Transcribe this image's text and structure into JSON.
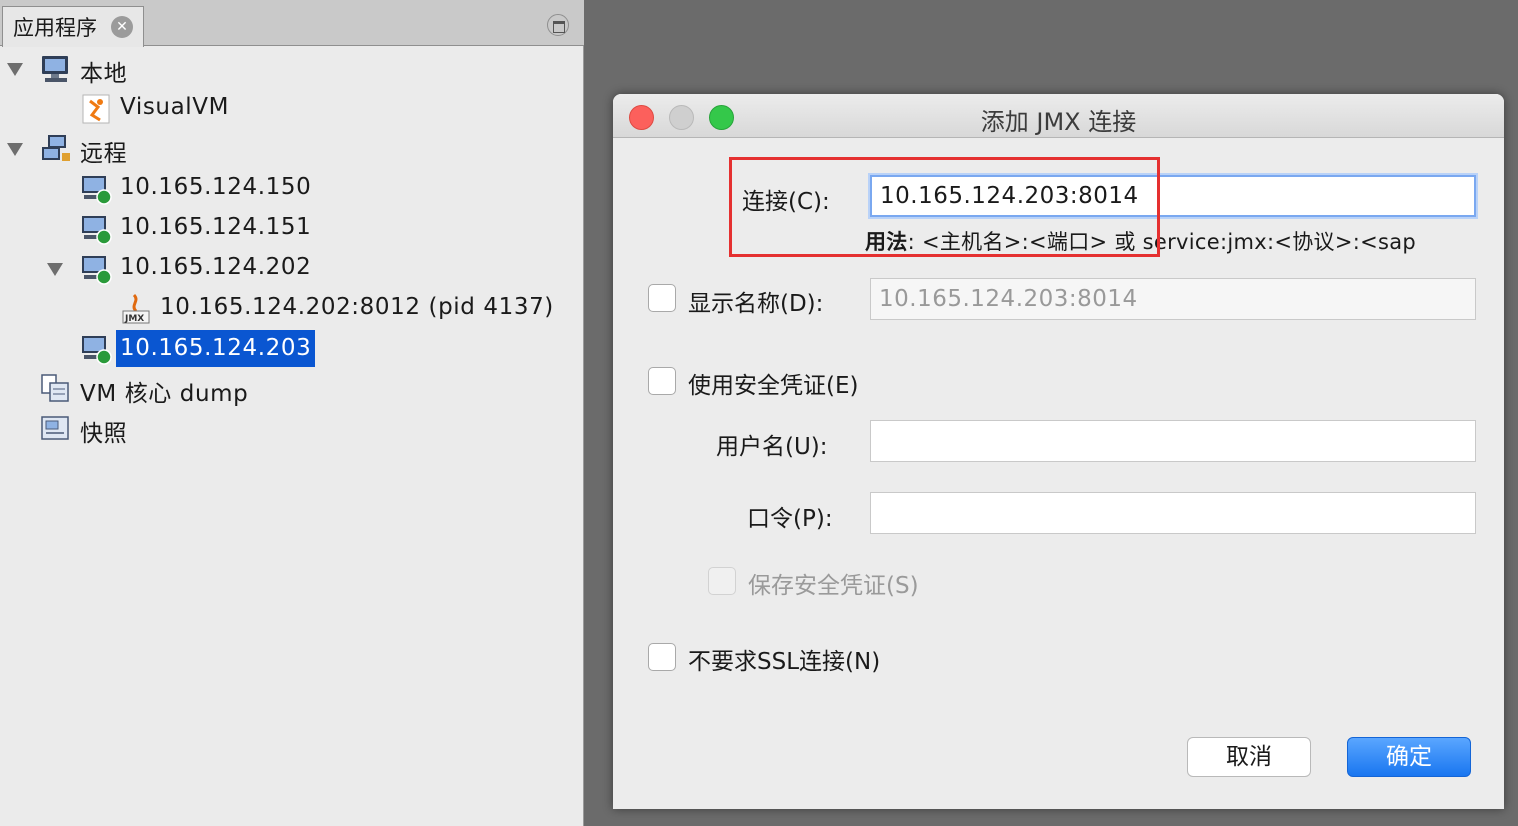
{
  "panel": {
    "tab_label": "应用程序",
    "tab_close_glyph": "✕"
  },
  "tree": {
    "local": "本地",
    "visualvm": "VisualVM",
    "remote": "远程",
    "host1": "10.165.124.150",
    "host2": "10.165.124.151",
    "host3": "10.165.124.202",
    "host3_child": "10.165.124.202:8012 (pid 4137)",
    "host4": "10.165.124.203",
    "coredump": "VM 核心 dump",
    "snapshot": "快照"
  },
  "dialog": {
    "title": "添加 JMX 连接",
    "connection_label": "连接(C):",
    "connection_value": "10.165.124.203:8014",
    "usage_prefix": "用法",
    "usage_text": ": <主机名>:<端口> 或 service:jmx:<协议>:<sap",
    "display_name_label": "显示名称(D):",
    "display_name_value": "10.165.124.203:8014",
    "use_credentials_label": "使用安全凭证(E)",
    "username_label": "用户名(U):",
    "username_value": "",
    "password_label": "口令(P):",
    "password_value": "",
    "save_credentials_label": "保存安全凭证(S)",
    "no_ssl_label": "不要求SSL连接(N)",
    "cancel_label": "取消",
    "ok_label": "确定"
  },
  "colors": {
    "selection": "#0a56d1",
    "highlight_box": "#e53030",
    "ok_button": "#1976f0"
  },
  "icons": {
    "local": "computer-icon",
    "visualvm": "java-app-icon",
    "remote": "network-icon",
    "remote_host": "remote-host-icon",
    "jmx_app": "jmx-app-icon",
    "coredump": "coredump-icon",
    "snapshot": "snapshot-icon"
  }
}
